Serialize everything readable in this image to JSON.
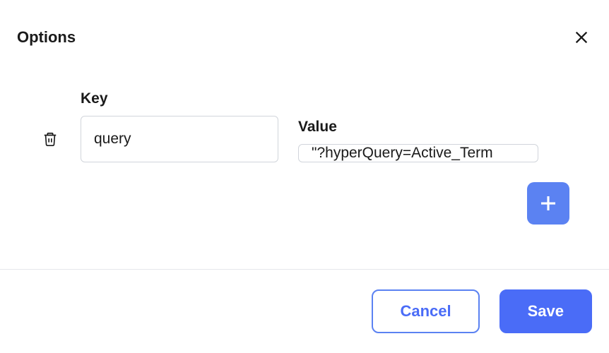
{
  "title": "Options",
  "labels": {
    "key": "Key",
    "value": "Value"
  },
  "row": {
    "key": "query",
    "value": "\"?hyperQuery=Active_Term"
  },
  "buttons": {
    "cancel": "Cancel",
    "save": "Save"
  }
}
